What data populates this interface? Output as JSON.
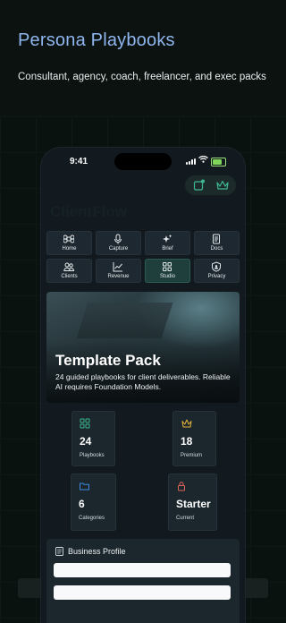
{
  "promo": {
    "title": "Persona Playbooks",
    "subtitle": "Consultant, agency, coach, freelancer, and exec packs"
  },
  "status_bar": {
    "time": "9:41"
  },
  "app": {
    "title": "ClientFlow"
  },
  "nav": [
    {
      "label": "Home",
      "icon": "command-icon"
    },
    {
      "label": "Capture",
      "icon": "microphone-icon"
    },
    {
      "label": "Brief",
      "icon": "sparkles-icon"
    },
    {
      "label": "Docs",
      "icon": "document-icon"
    },
    {
      "label": "Clients",
      "icon": "people-icon"
    },
    {
      "label": "Revenue",
      "icon": "chart-icon"
    },
    {
      "label": "Studio",
      "icon": "grid-icon",
      "active": true
    },
    {
      "label": "Privacy",
      "icon": "shield-icon"
    }
  ],
  "hero": {
    "title": "Template Pack",
    "description": "24 guided playbooks for client deliverables. Reliable AI requires Foundation Models."
  },
  "stats": [
    {
      "value": "24",
      "label": "Playbooks",
      "icon": "grid-icon",
      "color": "#3fb88f"
    },
    {
      "value": "18",
      "label": "Premium",
      "icon": "crown-icon",
      "color": "#e0b13a"
    },
    {
      "value": "6",
      "label": "Categories",
      "icon": "folder-icon",
      "color": "#3d8ce0"
    },
    {
      "value": "Starter",
      "label": "Current",
      "icon": "lock-icon",
      "color": "#e0655a"
    }
  ],
  "profile": {
    "title": "Business Profile"
  },
  "colors": {
    "accent": "#3fb88f",
    "promo_title": "#8fb6ee",
    "active_tab": "#1f3f3c"
  }
}
